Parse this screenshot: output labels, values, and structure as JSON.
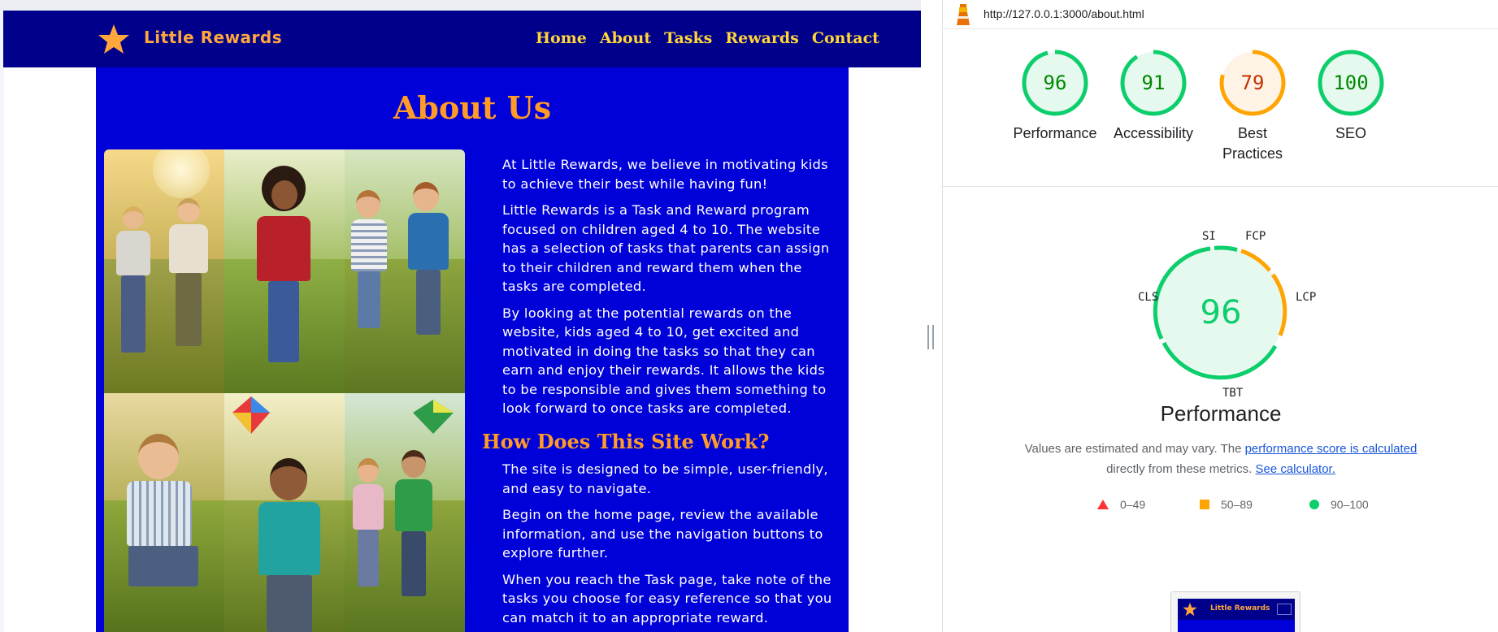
{
  "site": {
    "brand": "Little Rewards",
    "nav": [
      "Home",
      "About",
      "Tasks",
      "Rewards",
      "Contact"
    ],
    "title": "About Us",
    "about_paragraphs": [
      "At Little Rewards, we believe in motivating kids to achieve their best while having fun!",
      "Little Rewards is a Task and Reward program focused on children aged 4 to 10. The website has a selection of tasks that parents can assign to their children and reward them when the tasks are completed.",
      "By looking at the potential rewards on the website, kids aged 4 to 10, get excited and motivated in doing the tasks so that they can earn and enjoy their rewards. It allows the kids to be responsible and gives them something to look forward to once tasks are completed."
    ],
    "how_heading": "How Does This Site Work?",
    "how_paragraphs": [
      "The site is designed to be simple, user-friendly, and easy to navigate.",
      "Begin on the home page, review the available information, and use the navigation buttons to explore further.",
      "When you reach the Task page, take note of the tasks you choose for easy reference so that you can match it to an appropriate reward."
    ],
    "colors": {
      "navbar": "#00008b",
      "content": "#0000d8",
      "accent": "#ff9b26",
      "nav_link": "#ffd53a"
    }
  },
  "lighthouse": {
    "url": "http://127.0.0.1:3000/about.html",
    "scores": [
      {
        "label": "Performance",
        "value": 96,
        "status": "good"
      },
      {
        "label": "Accessibility",
        "value": 91,
        "status": "good"
      },
      {
        "label": "Best Practices",
        "value": 79,
        "status": "average"
      },
      {
        "label": "SEO",
        "value": 100,
        "status": "good"
      }
    ],
    "performance": {
      "score": 96,
      "title": "Performance",
      "metrics": [
        "SI",
        "FCP",
        "LCP",
        "TBT",
        "CLS"
      ],
      "note_prefix": "Values are estimated and may vary. The ",
      "note_link1": "performance score is calculated",
      "note_middle": " directly from these metrics. ",
      "note_link2": "See calculator."
    },
    "legend": [
      {
        "range": "0–49",
        "shape": "triangle",
        "color": "#f33"
      },
      {
        "range": "50–89",
        "shape": "square",
        "color": "#ffa400"
      },
      {
        "range": "90–100",
        "shape": "circle",
        "color": "#0cce6b"
      }
    ],
    "thumbnail_brand": "Little Rewards",
    "status_colors": {
      "good": "#0cce6b",
      "average": "#ffa400"
    }
  }
}
